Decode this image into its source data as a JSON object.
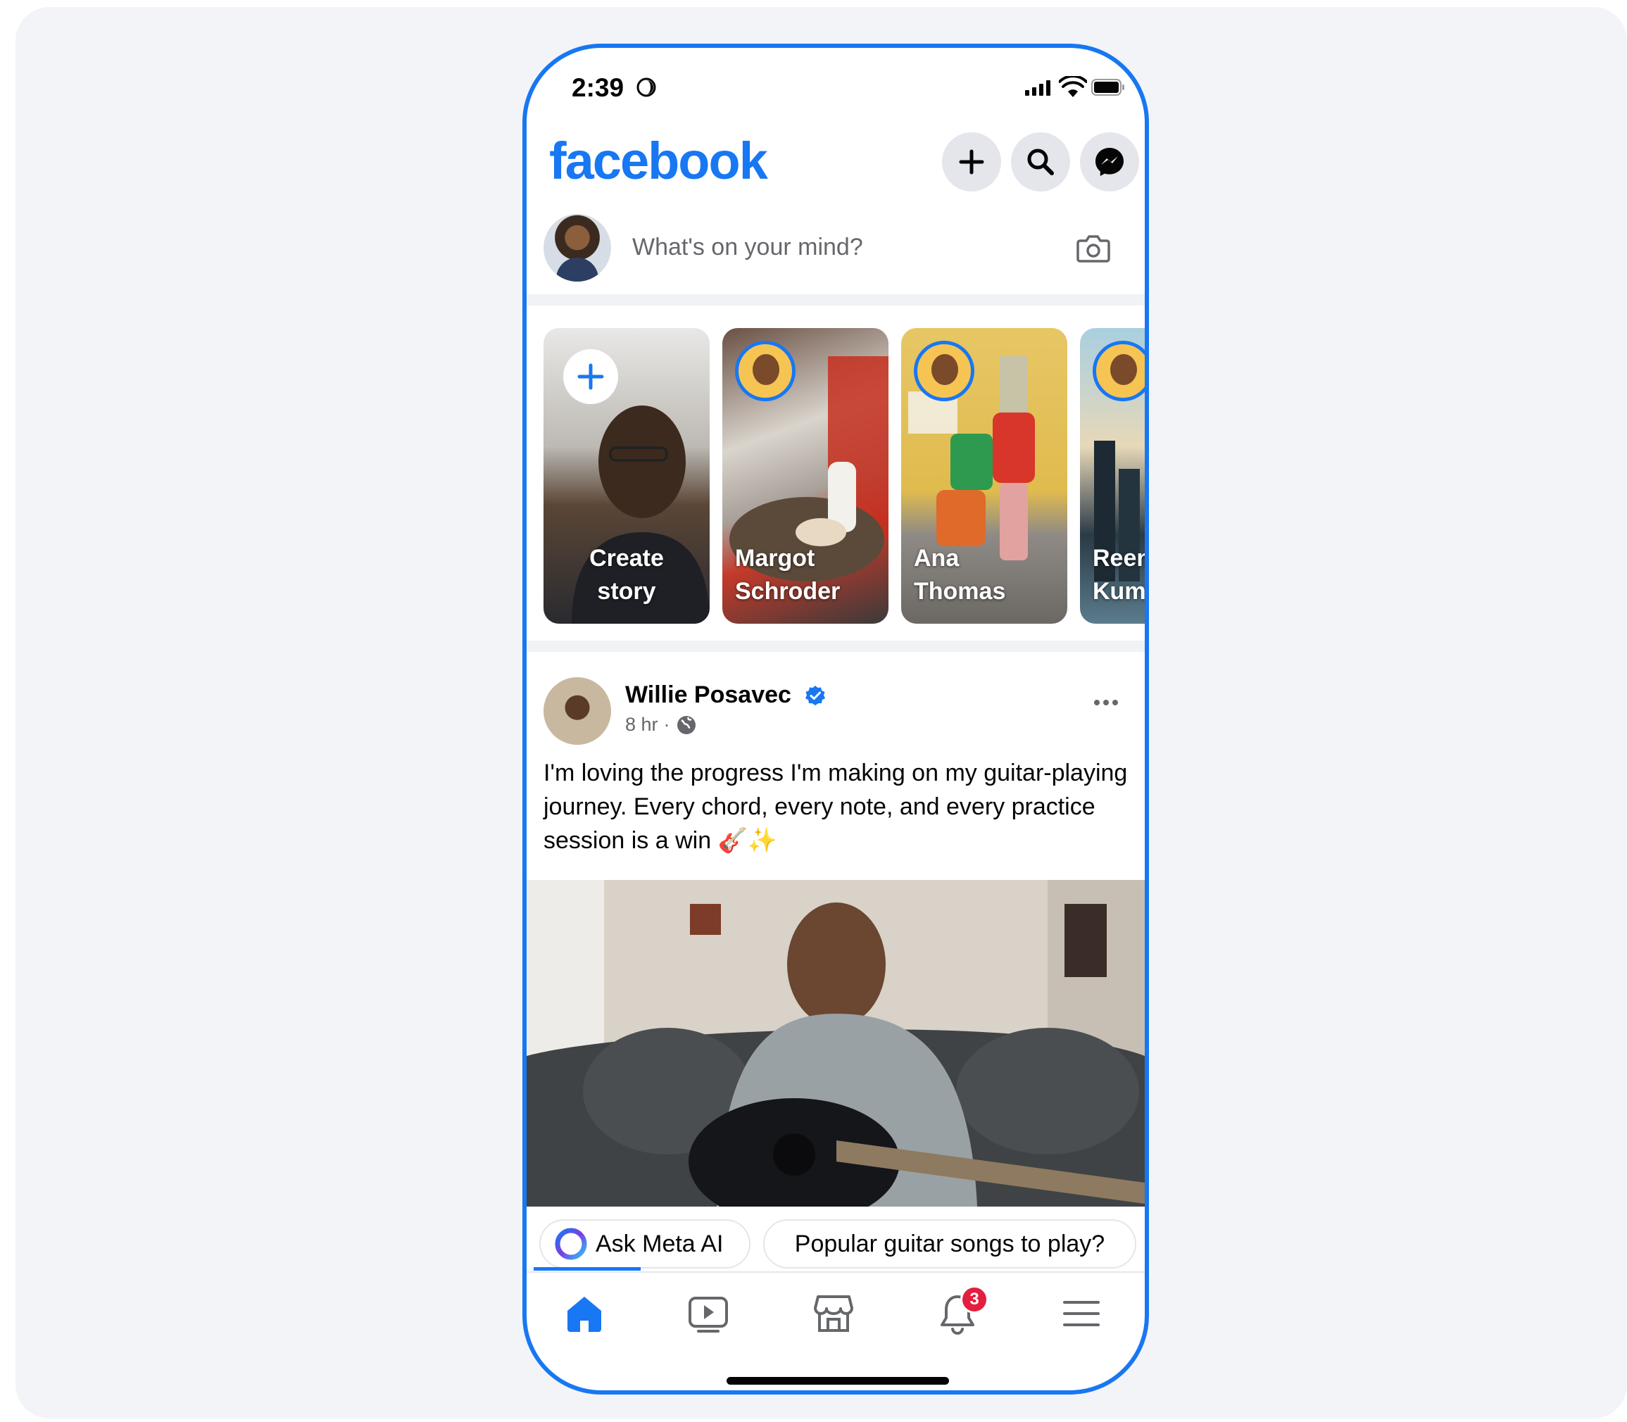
{
  "status_bar": {
    "time": "2:39"
  },
  "header": {
    "logo": "facebook"
  },
  "composer": {
    "placeholder": "What's on your mind?"
  },
  "stories": [
    {
      "name": "Create\nstory"
    },
    {
      "name": "Margot\nSchroder"
    },
    {
      "name": "Ana\nThomas"
    },
    {
      "name": "Reen\nKum"
    }
  ],
  "post": {
    "author": "Willie Posavec",
    "time": "8 hr",
    "separator": "·",
    "text": "I'm loving the progress I'm making on my guitar-playing journey. Every chord, every note, and every practice session is a win 🎸✨"
  },
  "chips": [
    {
      "label": "Ask Meta AI"
    },
    {
      "label": "Popular guitar songs to play?"
    }
  ],
  "tab_bar": {
    "notifications_badge": "3"
  },
  "colors": {
    "brand": "#1877f2",
    "badge": "#e41e3f",
    "text": "#050505",
    "muted": "#65676b"
  }
}
